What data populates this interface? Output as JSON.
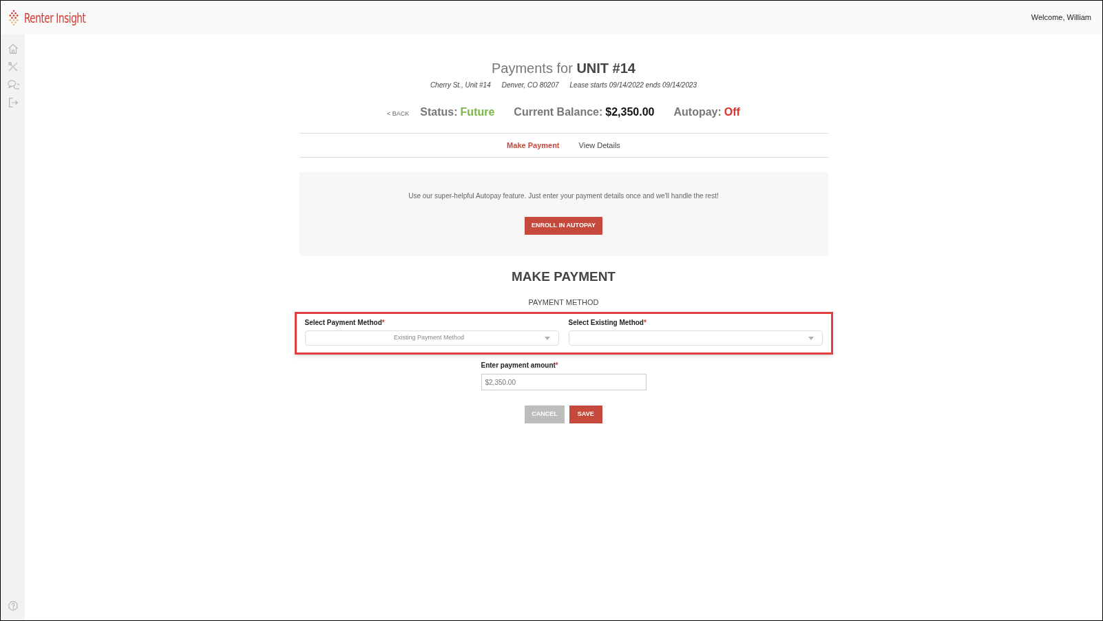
{
  "header": {
    "brand": "Renter Insight",
    "welcome": "Welcome, William"
  },
  "sidebar": {
    "items": [
      {
        "kind": "home"
      },
      {
        "kind": "tools"
      },
      {
        "kind": "chat"
      },
      {
        "kind": "logout"
      }
    ],
    "help": {
      "kind": "help"
    }
  },
  "page": {
    "title_prefix": "Payments for",
    "title_unit": "UNIT #14",
    "address": [
      "Cherry St., Unit #14",
      "Denver, CO 80207",
      "Lease starts 09/14/2022 ends 09/14/2023"
    ],
    "back": "< BACK",
    "stats": [
      {
        "label": "Status:",
        "value": "Future",
        "color": "#7ab648"
      },
      {
        "label": "Current Balance:",
        "value": "$2,350.00",
        "color": "#111111"
      },
      {
        "label": "Autopay:",
        "value": "Off",
        "color": "#d9342b"
      }
    ]
  },
  "tabs": [
    {
      "label": "Make Payment",
      "selected": true
    },
    {
      "label": "View Details",
      "selected": false
    }
  ],
  "autopay_banner": {
    "text": "Use our super-helpful Autopay feature. Just enter your payment details once and we'll handle the rest!",
    "button": "ENROLL IN AUTOPAY"
  },
  "form": {
    "title": "MAKE PAYMENT",
    "section": "PAYMENT METHOD",
    "selects": [
      {
        "label": "Select Payment Method",
        "required_mark": "*",
        "value": "Existing Payment Method"
      },
      {
        "label": "Select Existing Method",
        "required_mark": "*"
      }
    ],
    "amount": {
      "label": "Enter payment amount",
      "required_mark": "*",
      "value": "$2,350.00"
    },
    "buttons": [
      {
        "label": "CANCEL",
        "kind": "secondary"
      },
      {
        "label": "SAVE",
        "kind": "primary"
      }
    ]
  }
}
